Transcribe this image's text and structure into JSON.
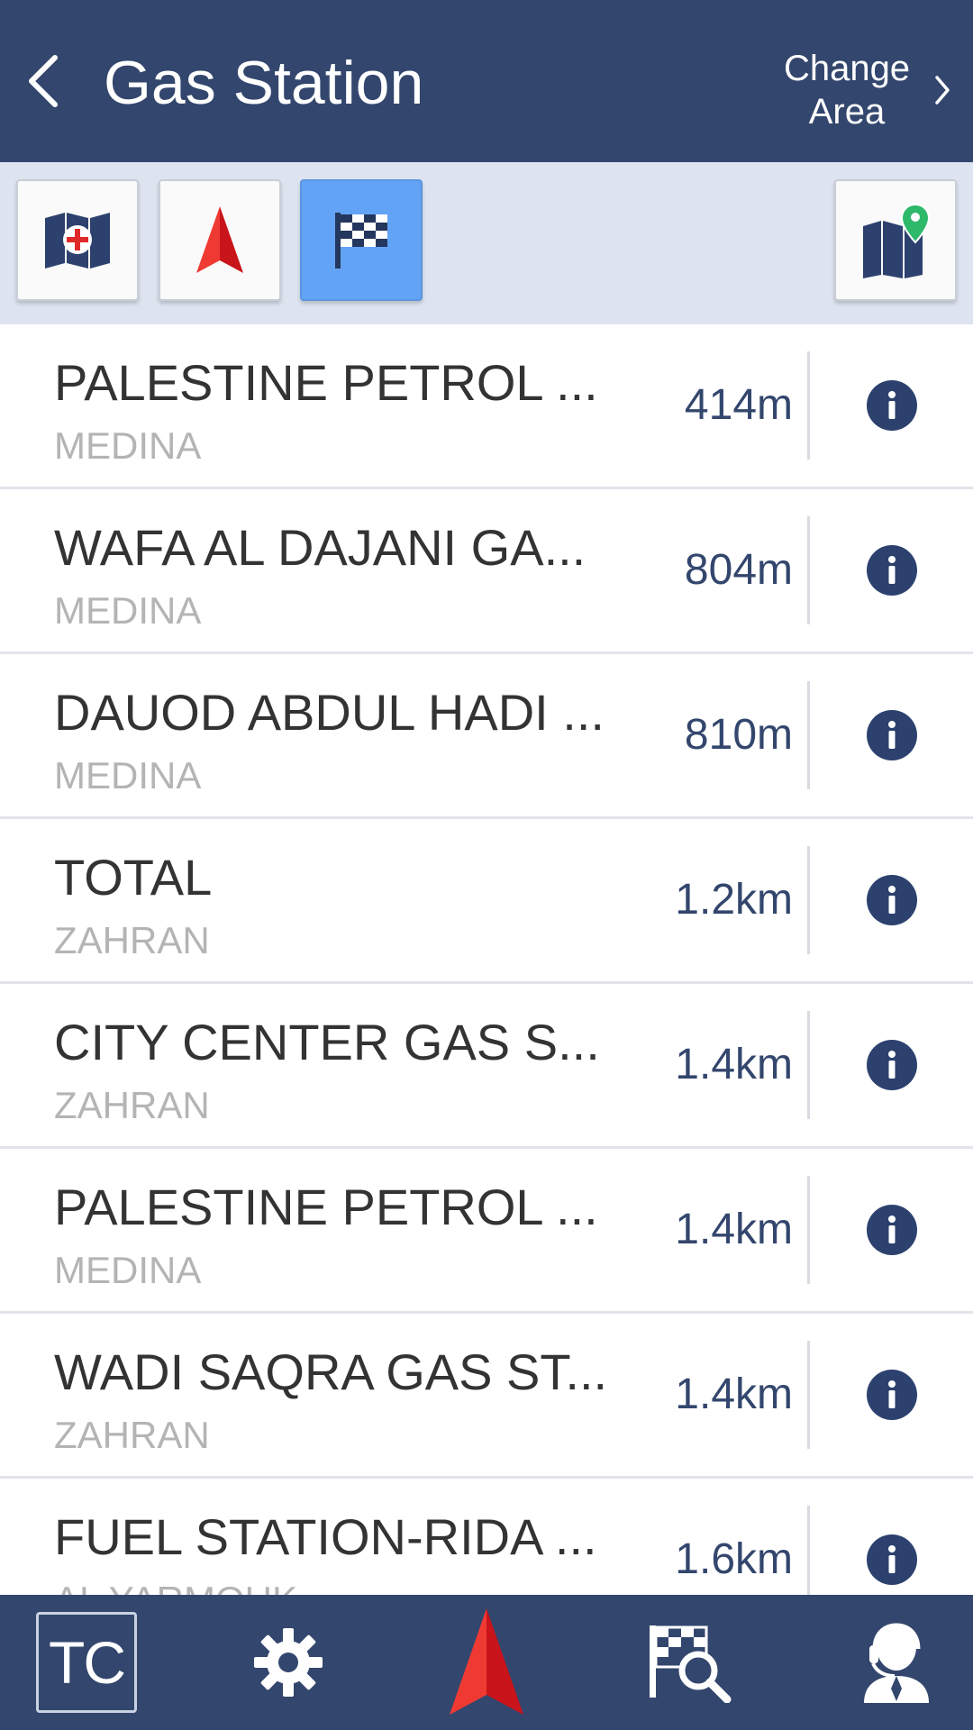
{
  "header": {
    "title": "Gas Station",
    "change_area_label": "Change\nArea",
    "background_color": "#33466d"
  },
  "toolbar": {
    "buttons": [
      {
        "icon": "map-plus-icon",
        "active": false
      },
      {
        "icon": "navigation-arrow-icon",
        "active": false
      },
      {
        "icon": "checkered-flag-icon",
        "active": true
      },
      {
        "icon": "map-pin-icon",
        "active": false
      }
    ],
    "active_color": "#63a3f5"
  },
  "results": [
    {
      "name": "PALESTINE PETROL ...",
      "area": "MEDINA",
      "distance": "414m"
    },
    {
      "name": "WAFA AL DAJANI GA...",
      "area": "MEDINA",
      "distance": "804m"
    },
    {
      "name": "DAUOD ABDUL HADI ...",
      "area": "MEDINA",
      "distance": "810m"
    },
    {
      "name": "TOTAL",
      "area": "ZAHRAN",
      "distance": "1.2km"
    },
    {
      "name": "CITY CENTER GAS S...",
      "area": "ZAHRAN",
      "distance": "1.4km"
    },
    {
      "name": "PALESTINE PETROL ...",
      "area": "MEDINA",
      "distance": "1.4km"
    },
    {
      "name": "WADI SAQRA GAS ST...",
      "area": "ZAHRAN",
      "distance": "1.4km"
    },
    {
      "name": "FUEL STATION-RIDA ...",
      "area": "AL YARMOUK",
      "distance": "1.6km"
    }
  ],
  "bottom_nav": {
    "tc_label": "TC",
    "items": [
      "tc-icon",
      "settings-gear-icon",
      "navigation-arrow-icon",
      "flag-search-icon",
      "support-agent-icon"
    ]
  }
}
